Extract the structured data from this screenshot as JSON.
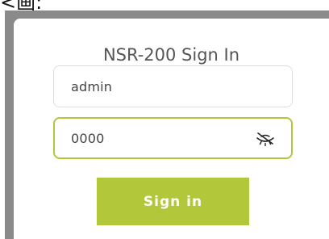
{
  "top_fragment": "<画:",
  "login": {
    "title": "NSR-200 Sign In",
    "username_value": "admin",
    "password_value": "0000",
    "password_toggle_icon": "eye-slash-icon",
    "sign_in_label": "Sign in"
  },
  "colors": {
    "accent": "#b2c73a",
    "panel_border": "#8a8a8a",
    "text": "#555555"
  }
}
